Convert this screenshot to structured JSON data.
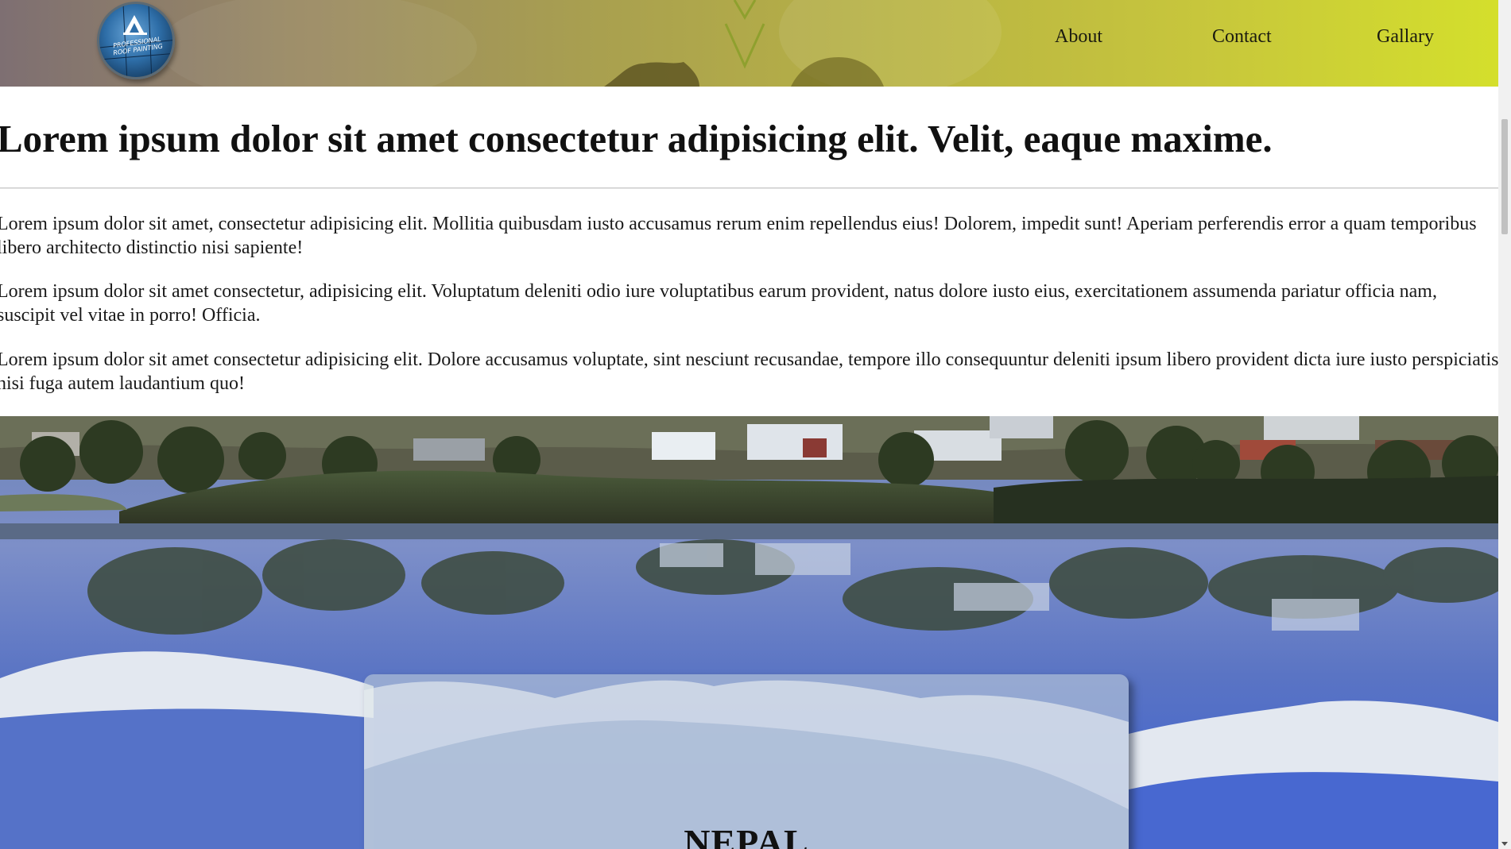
{
  "header": {
    "logo_text": "PROFESSIONAL ROOF PAINTING",
    "nav": [
      {
        "label": "About"
      },
      {
        "label": "Contact"
      },
      {
        "label": "Gallary"
      }
    ]
  },
  "main": {
    "title": "Lorem ipsum dolor sit amet consectetur adipisicing elit. Velit, eaque maxime.",
    "paragraphs": [
      "Lorem ipsum dolor sit amet, consectetur adipisicing elit. Mollitia quibusdam iusto accusamus rerum enim repellendus eius! Dolorem, impedit sunt! Aperiam perferendis error a quam temporibus libero architecto distinctio nisi sapiente!",
      "Lorem ipsum dolor sit amet consectetur, adipisicing elit. Voluptatum deleniti odio iure voluptatibus earum provident, natus dolore iusto eius, exercitationem assumenda pariatur officia nam, suscipit vel vitae in porro! Officia.",
      "Lorem ipsum dolor sit amet consectetur adipisicing elit. Dolore accusamus voluptate, sint nesciunt recusandae, tempore illo consequuntur deleniti ipsum libero provident dicta iure iusto perspiciatis nisi fuga autem laudantium quo!"
    ]
  },
  "banner": {
    "card_heading": "NEPAL"
  },
  "colors": {
    "header_start": "#7e6f72",
    "header_end": "#d4df2c",
    "water": "#5a74c4",
    "sky_reflection": "#3a5fd0"
  }
}
